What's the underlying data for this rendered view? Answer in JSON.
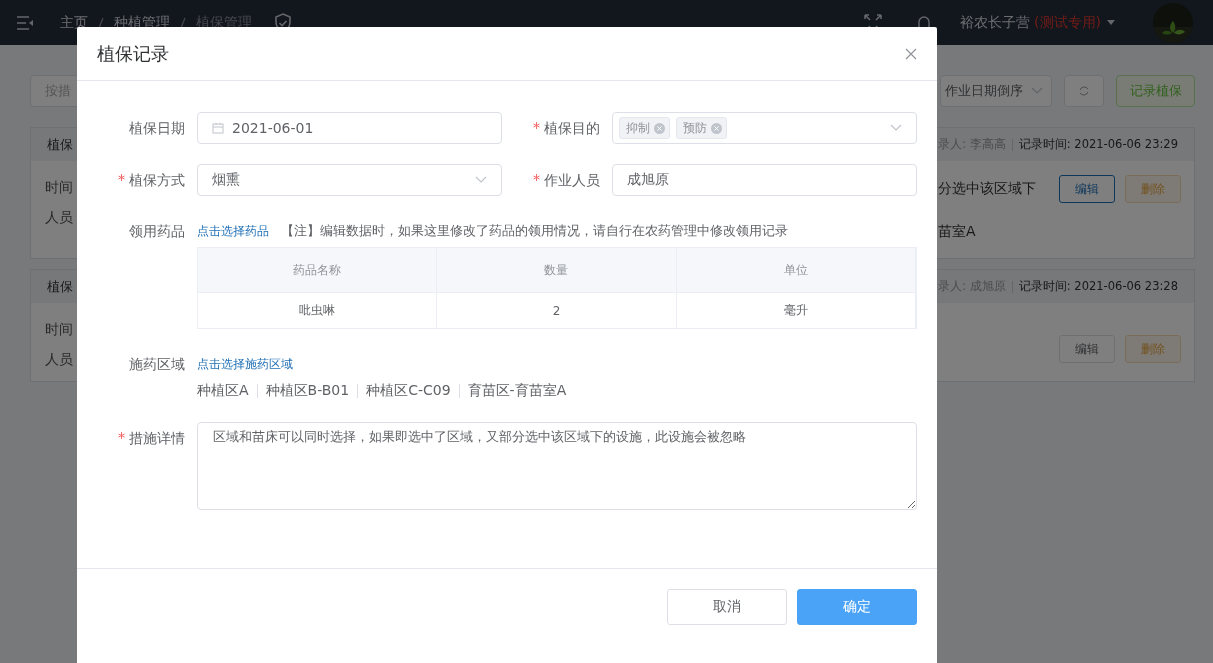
{
  "header": {
    "breadcrumbs": [
      "主页",
      "种植管理",
      "植保管理"
    ],
    "user": {
      "name": "裕农长子营",
      "tag": "(测试专用)"
    }
  },
  "toolbar": {
    "search_placeholder": "按措",
    "sort": "作业日期倒序",
    "add_button": "记录植保"
  },
  "records": [
    {
      "title": "植保",
      "labels": [
        "时间",
        "人员"
      ],
      "recorder": "录人: 李高高",
      "time": "记录时间: 2021-06-06 23:29",
      "details": [
        "分选中该区域下",
        "苗室A"
      ],
      "edit": {
        "label": "编辑",
        "selected": true
      },
      "delete": "删除"
    },
    {
      "title": "植保",
      "labels": [
        "时间",
        "人员"
      ],
      "recorder": "录人: 成旭原",
      "time": "记录时间: 2021-06-06 23:28",
      "edit": {
        "label": "编辑",
        "selected": false
      },
      "delete": "删除"
    }
  ],
  "dialog": {
    "title": "植保记录",
    "fields": [
      {
        "kind": "date",
        "label": "植保日期",
        "required": false,
        "value": "2021-06-01"
      },
      {
        "kind": "tags",
        "label": "植保目的",
        "required": true,
        "tags": [
          "抑制",
          "预防"
        ]
      },
      {
        "kind": "select",
        "label": "植保方式",
        "required": true,
        "value": "烟熏"
      },
      {
        "kind": "text",
        "label": "作业人员",
        "required": true,
        "value": "成旭原"
      }
    ],
    "medicine": {
      "label": "领用药品",
      "link": "点击选择药品",
      "note": "【注】编辑数据时，如果这里修改了药品的领用情况，请自行在农药管理中修改领用记录",
      "table": {
        "columns": [
          "药品名称",
          "数量",
          "单位"
        ],
        "rows": [
          [
            "吡虫啉",
            "2",
            "毫升"
          ]
        ]
      }
    },
    "area": {
      "label": "施药区域",
      "link": "点击选择施药区域",
      "areas": [
        "种植区A",
        "种植区B-B01",
        "种植区C-C09",
        "育苗区-育苗室A"
      ]
    },
    "details": {
      "label": "措施详情",
      "required": true,
      "value": "区域和苗床可以同时选择，如果即选中了区域，又部分选中该区域下的设施，此设施会被忽略"
    },
    "buttons": [
      {
        "kind": "secondary",
        "label": "取消"
      },
      {
        "kind": "primary",
        "label": "确定"
      }
    ]
  }
}
